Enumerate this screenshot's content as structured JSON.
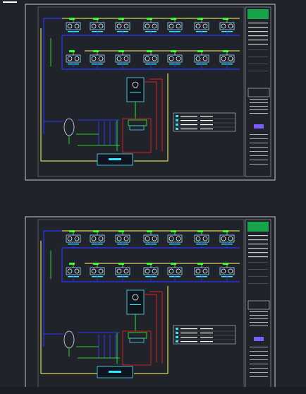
{
  "drawings": [
    {
      "id": "sheet-1",
      "unit_codes_row1": [
        "",
        "",
        "",
        "",
        "",
        "",
        ""
      ],
      "unit_codes_row2": [
        "",
        "",
        "",
        "",
        "",
        "",
        ""
      ],
      "title_block": {
        "logo_text": "",
        "rows": [
          "",
          "",
          "",
          "",
          "",
          ""
        ]
      },
      "legend_rows": [
        "",
        "",
        "",
        ""
      ]
    },
    {
      "id": "sheet-2",
      "unit_codes_row1": [
        "",
        "",
        "",
        "",
        "",
        "",
        ""
      ],
      "unit_codes_row2": [
        "",
        "",
        "",
        "",
        "",
        "",
        ""
      ],
      "title_block": {
        "logo_text": "",
        "rows": [
          "",
          "",
          "",
          "",
          "",
          ""
        ]
      },
      "legend_rows": [
        "",
        "",
        "",
        ""
      ]
    }
  ],
  "colors": {
    "background": "#20242a",
    "frame": "#c8c8c8",
    "supply_line": "#2b36ff",
    "return_line": "#ffff66",
    "accent_green": "#2fff2f",
    "accent_cyan": "#32e8ff",
    "accent_red": "#e02020",
    "equipment": "#4dd0e1",
    "logo_bg": "#16a34a"
  },
  "icons": {
    "fan_coil_unit": "fcu-icon",
    "cooling_tower": "cooling-tower-icon",
    "chiller": "chiller-icon",
    "expansion_tank": "expansion-tank-icon",
    "pump": "pump-icon"
  }
}
